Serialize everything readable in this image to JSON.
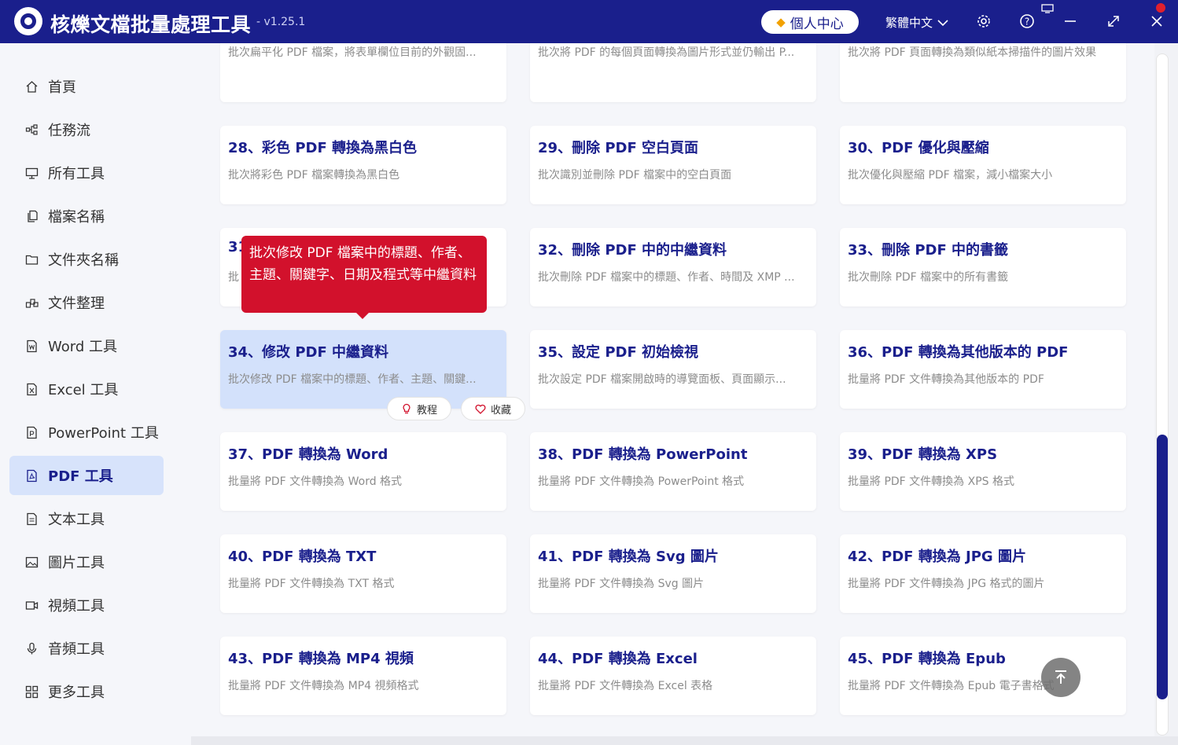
{
  "app": {
    "title": "核爍文檔批量處理工具",
    "version": "- v1.25.1"
  },
  "header": {
    "user_center": "個人中心",
    "language": "繁體中文"
  },
  "sidebar": {
    "items": [
      {
        "label": "首頁",
        "icon": "home-icon"
      },
      {
        "label": "任務流",
        "icon": "workflow-icon"
      },
      {
        "label": "所有工具",
        "icon": "monitor-icon"
      },
      {
        "label": "檔案名稱",
        "icon": "file-copy-icon"
      },
      {
        "label": "文件夾名稱",
        "icon": "folder-icon"
      },
      {
        "label": "文件整理",
        "icon": "organize-icon"
      },
      {
        "label": "Word 工具",
        "icon": "word-icon"
      },
      {
        "label": "Excel 工具",
        "icon": "excel-icon"
      },
      {
        "label": "PowerPoint 工具",
        "icon": "powerpoint-icon"
      },
      {
        "label": "PDF 工具",
        "icon": "pdf-icon",
        "active": true
      },
      {
        "label": "文本工具",
        "icon": "text-icon"
      },
      {
        "label": "圖片工具",
        "icon": "image-icon"
      },
      {
        "label": "視頻工具",
        "icon": "video-icon"
      },
      {
        "label": "音頻工具",
        "icon": "microphone-icon"
      },
      {
        "label": "更多工具",
        "icon": "grid-icon"
      }
    ]
  },
  "cards_top": [
    "批次扁平化 PDF 檔案，將表單欄位目前的外觀固...",
    "批次將 PDF 的每個頁面轉換為圖片形式並仍輸出 P...",
    "批次將 PDF 頁面轉換為類似紙本掃描件的圖片效果"
  ],
  "cards": [
    {
      "title": "28、彩色 PDF 轉換為黑白色",
      "desc": "批次將彩色 PDF 檔案轉換為黑白色"
    },
    {
      "title": "29、刪除 PDF 空白頁面",
      "desc": "批次識別並刪除 PDF 檔案中的空白頁面"
    },
    {
      "title": "30、PDF 優化與壓縮",
      "desc": "批次優化與壓縮 PDF 檔案，減小檔案大小"
    },
    {
      "title": "31",
      "desc": "批"
    },
    {
      "title": "32、刪除 PDF 中的中繼資料",
      "desc": "批次刪除 PDF 檔案中的標題、作者、時間及 XMP ..."
    },
    {
      "title": "33、刪除 PDF 中的書籤",
      "desc": "批次刪除 PDF 檔案中的所有書籤"
    },
    {
      "title": "34、修改 PDF 中繼資料",
      "desc": "批次修改 PDF 檔案中的標題、作者、主題、關鍵..."
    },
    {
      "title": "35、設定 PDF 初始檢視",
      "desc": "批次設定 PDF 檔案開啟時的導覽面板、頁面顯示..."
    },
    {
      "title": "36、PDF 轉換為其他版本的 PDF",
      "desc": "批量將 PDF 文件轉換為其他版本的 PDF"
    },
    {
      "title": "37、PDF 轉換為 Word",
      "desc": "批量將 PDF 文件轉換為 Word 格式"
    },
    {
      "title": "38、PDF 轉換為 PowerPoint",
      "desc": "批量將 PDF 文件轉換為 PowerPoint 格式"
    },
    {
      "title": "39、PDF 轉換為 XPS",
      "desc": "批量將 PDF 文件轉換為 XPS 格式"
    },
    {
      "title": "40、PDF 轉換為 TXT",
      "desc": "批量將 PDF 文件轉換為 TXT 格式"
    },
    {
      "title": "41、PDF 轉換為 Svg 圖片",
      "desc": "批量將 PDF 文件轉換為 Svg 圖片"
    },
    {
      "title": "42、PDF 轉換為 JPG 圖片",
      "desc": "批量將 PDF 文件轉換為 JPG 格式的圖片"
    },
    {
      "title": "43、PDF 轉換為 MP4 視頻",
      "desc": "批量將 PDF 文件轉換為 MP4 視頻格式"
    },
    {
      "title": "44、PDF 轉換為 Excel",
      "desc": "批量將 PDF 文件轉換為 Excel 表格"
    },
    {
      "title": "45、PDF 轉換為 Epub",
      "desc": "批量將 PDF 文件轉換為 Epub 電子書格式"
    }
  ],
  "hover_actions": {
    "tutorial": "教程",
    "favorite": "收藏"
  },
  "tooltip": "批次修改 PDF 檔案中的標題、作者、主題、關鍵字、日期及程式等中繼資料",
  "colors": {
    "primary": "#1a1f8c",
    "tooltip": "#d2112c",
    "highlight": "#d3e1fb"
  }
}
